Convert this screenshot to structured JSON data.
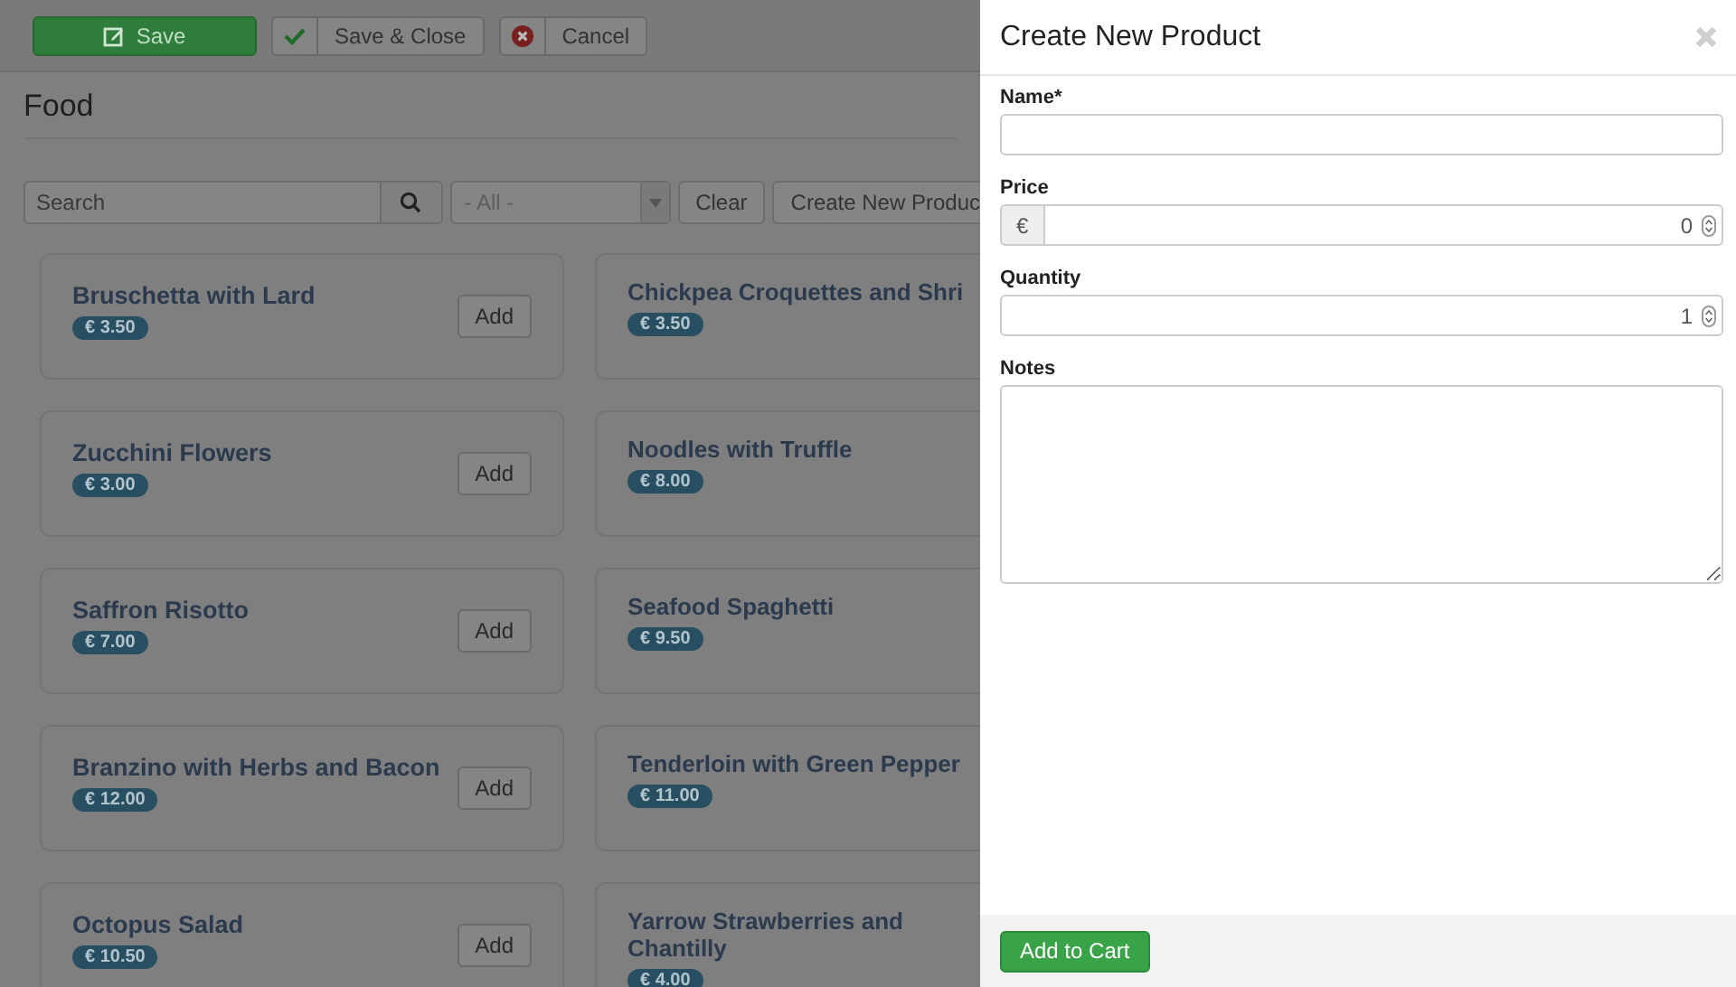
{
  "toolbar": {
    "buttons": [
      {
        "label": "Save",
        "kind": "primary"
      },
      {
        "label": "Save & Close",
        "kind": "check"
      },
      {
        "label": "Cancel",
        "kind": "cancel"
      }
    ]
  },
  "page_title": "Food",
  "filters": {
    "search_placeholder": "Search",
    "category": "- All -",
    "clear": "Clear",
    "create": "Create New Produc"
  },
  "products": [
    {
      "name": "Bruschetta with Lard",
      "price": "€ 3.50",
      "action": "Add"
    },
    {
      "name": "Chickpea Croquettes and Shri",
      "price": "€ 3.50"
    },
    {
      "name": "Zucchini Flowers",
      "price": "€ 3.00",
      "action": "Add"
    },
    {
      "name": "Noodles with Truffle",
      "price": "€ 8.00"
    },
    {
      "name": "Saffron Risotto",
      "price": "€ 7.00",
      "action": "Add"
    },
    {
      "name": "Seafood Spaghetti",
      "price": "€ 9.50"
    },
    {
      "name": "Branzino with Herbs and Bacon",
      "price": "€ 12.00",
      "action": "Add"
    },
    {
      "name": "Tenderloin with Green Pepper",
      "price": "€ 11.00"
    },
    {
      "name": "Octopus Salad",
      "price": "€ 10.50",
      "action": "Add"
    },
    {
      "name": "Yarrow Strawberries and Chantilly",
      "price": "€ 4.00"
    }
  ],
  "dialog": {
    "title": "Create New Product",
    "fields": [
      {
        "label": "Name*",
        "kind": "text"
      },
      {
        "label": "Price",
        "kind": "number",
        "prefix": "€",
        "value": "0"
      },
      {
        "label": "Quantity",
        "kind": "number",
        "value": "1"
      },
      {
        "label": "Notes",
        "kind": "textarea"
      }
    ],
    "submit": "Add to Cart"
  }
}
